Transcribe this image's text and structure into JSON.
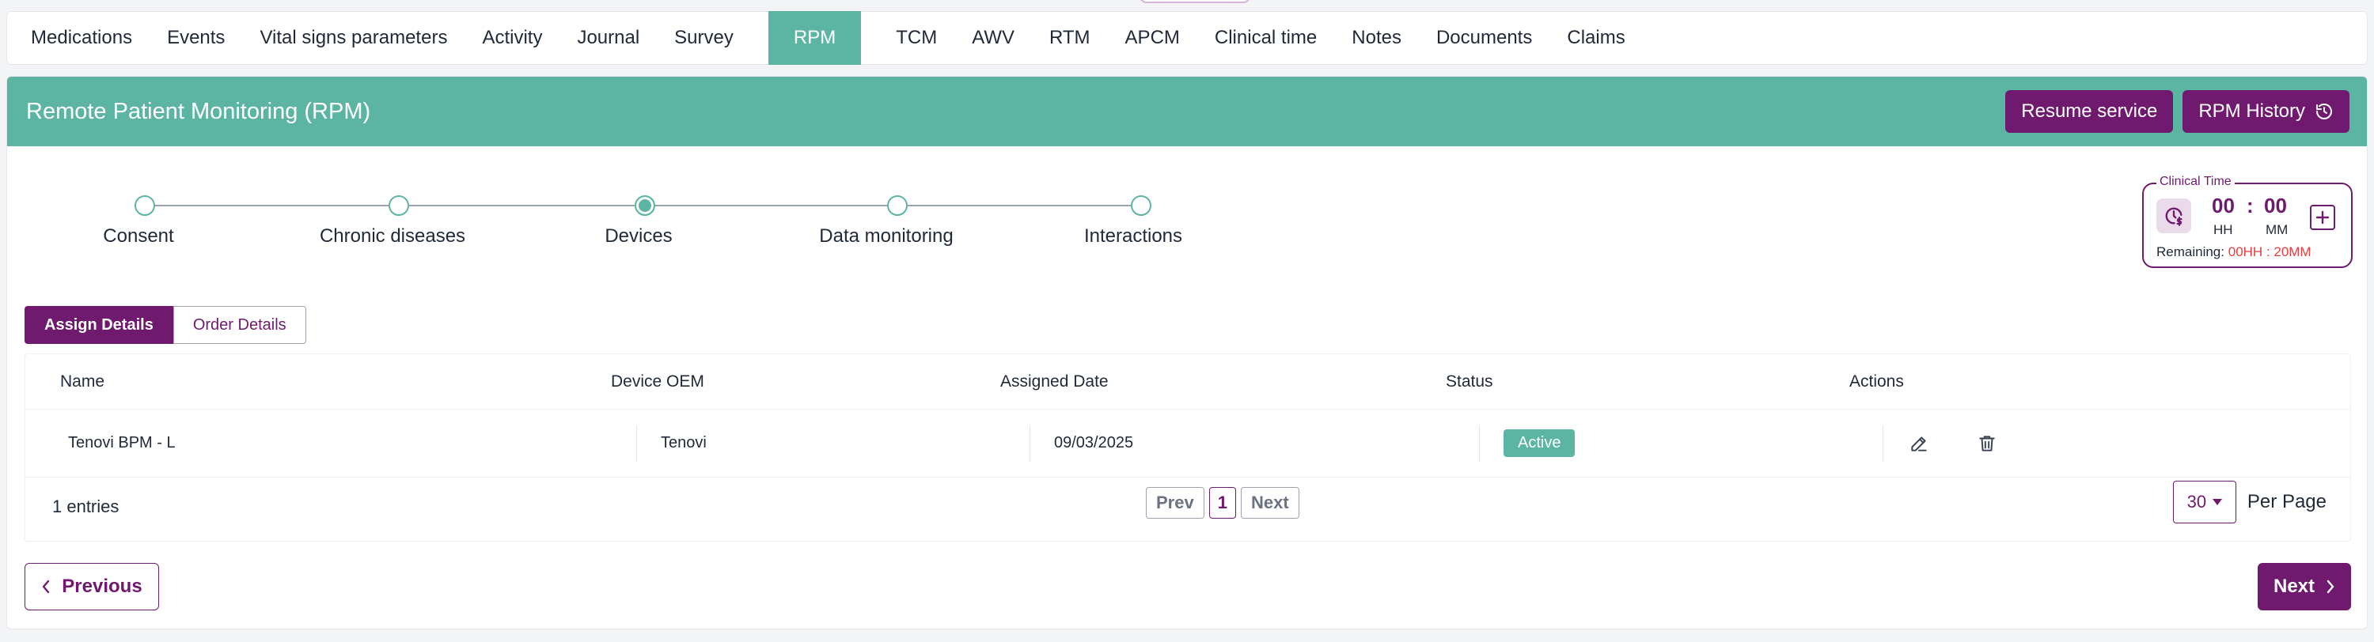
{
  "tabs": [
    {
      "label": "Medications",
      "active": false
    },
    {
      "label": "Events",
      "active": false
    },
    {
      "label": "Vital signs parameters",
      "active": false
    },
    {
      "label": "Activity",
      "active": false
    },
    {
      "label": "Journal",
      "active": false
    },
    {
      "label": "Survey",
      "active": false
    },
    {
      "label": "RPM",
      "active": true
    },
    {
      "label": "TCM",
      "active": false
    },
    {
      "label": "AWV",
      "active": false
    },
    {
      "label": "RTM",
      "active": false
    },
    {
      "label": "APCM",
      "active": false
    },
    {
      "label": "Clinical time",
      "active": false
    },
    {
      "label": "Notes",
      "active": false
    },
    {
      "label": "Documents",
      "active": false
    },
    {
      "label": "Claims",
      "active": false
    }
  ],
  "header": {
    "title": "Remote Patient Monitoring (RPM)",
    "resume_label": "Resume service",
    "history_label": "RPM History"
  },
  "stepper": {
    "steps": [
      "Consent",
      "Chronic diseases",
      "Devices",
      "Data monitoring",
      "Interactions"
    ],
    "current_index": 2
  },
  "clinical_time": {
    "legend": "Clinical Time",
    "hours": "00",
    "separator": ":",
    "minutes": "00",
    "hours_unit": "HH",
    "minutes_unit": "MM",
    "remaining_label": "Remaining:",
    "remaining_value": "00HH : 20MM"
  },
  "subtabs": {
    "assign": "Assign Details",
    "order": "Order Details"
  },
  "table": {
    "columns": [
      "Name",
      "Device OEM",
      "Assigned Date",
      "Status",
      "Actions"
    ],
    "rows": [
      {
        "name": "Tenovi BPM - L",
        "oem": "Tenovi",
        "date": "09/03/2025",
        "status": "Active"
      }
    ]
  },
  "footer": {
    "entries": "1 entries",
    "prev": "Prev",
    "page": "1",
    "next": "Next",
    "per_page_value": "30",
    "per_page_label": "Per Page"
  },
  "nav": {
    "previous": "Previous",
    "next": "Next"
  },
  "colors": {
    "teal": "#5bb5a2",
    "purple": "#6f1a6e",
    "remaining_red": "#e53e3e"
  }
}
